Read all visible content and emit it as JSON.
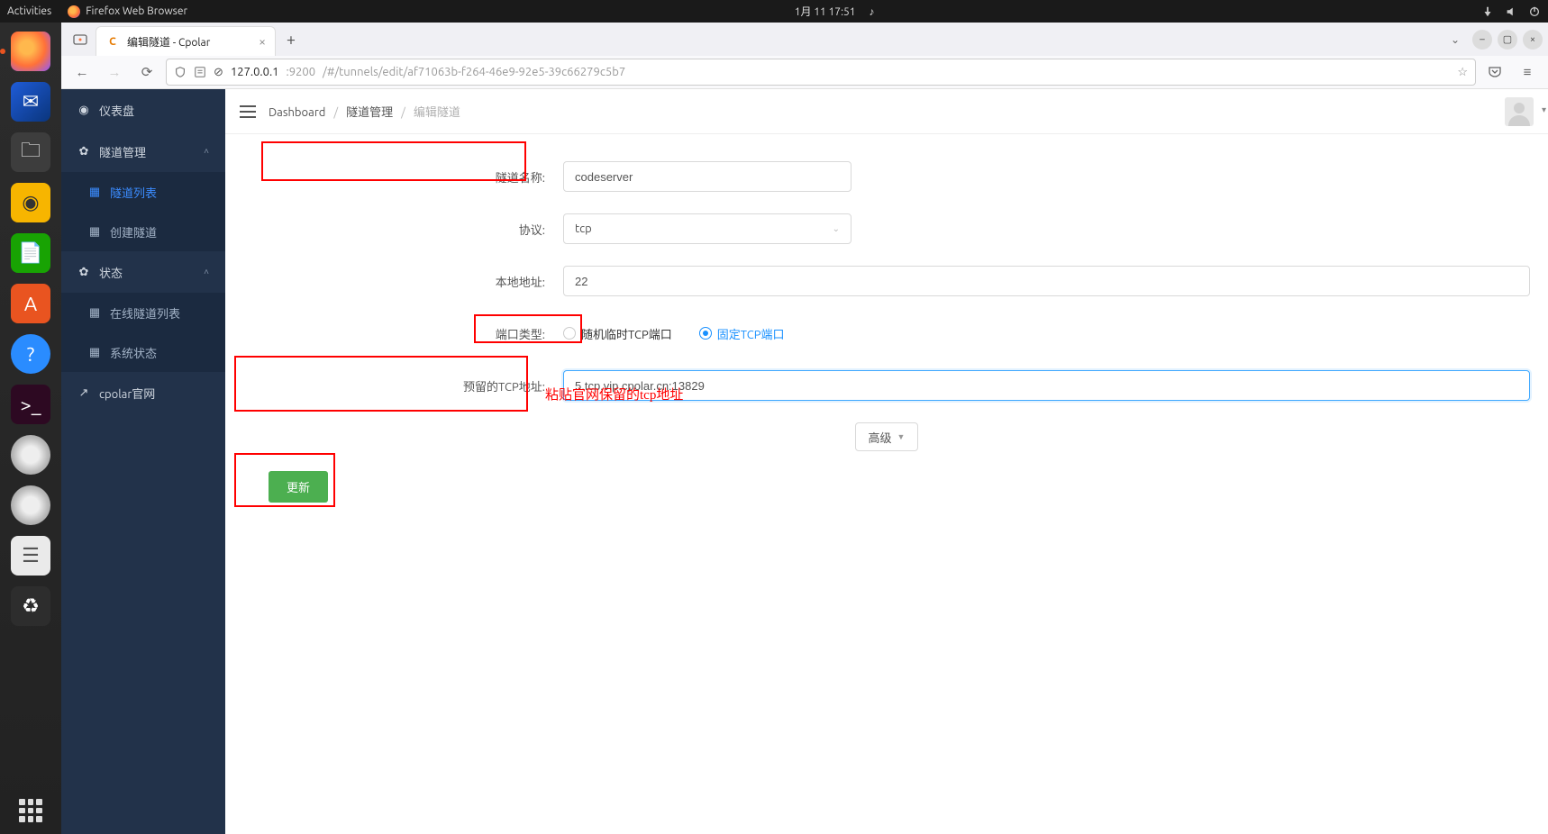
{
  "gnome": {
    "activities": "Activities",
    "app_name": "Firefox Web Browser",
    "datetime": "1月 11  17:51"
  },
  "browser": {
    "tab_title": "编辑隧道 - Cpolar",
    "tab_favicon_letter": "C",
    "url_host": "127.0.0.1",
    "url_port": ":9200",
    "url_path": "/#/tunnels/edit/af71063b-f264-46e9-92e5-39c66279c5b7"
  },
  "sidebar": {
    "dashboard": "仪表盘",
    "tunnel_mgmt": "隧道管理",
    "tunnel_list": "隧道列表",
    "create_tunnel": "创建隧道",
    "status": "状态",
    "online_tunnels": "在线隧道列表",
    "system_status": "系统状态",
    "cpolar_site": "cpolar官网"
  },
  "breadcrumb": {
    "a": "Dashboard",
    "b": "隧道管理",
    "c": "编辑隧道"
  },
  "labels": {
    "tunnel_name": "隧道名称:",
    "protocol": "协议:",
    "local_addr": "本地地址:",
    "port_type": "端口类型:",
    "reserved_tcp": "预留的TCP地址:"
  },
  "values": {
    "tunnel_name": "codeserver",
    "protocol": "tcp",
    "local_addr": "22",
    "reserved_tcp": "5.tcp.vip.cpolar.cn:13829"
  },
  "radios": {
    "random": "随机临时TCP端口",
    "fixed": "固定TCP端口"
  },
  "buttons": {
    "advanced": "高级",
    "update": "更新"
  },
  "annotation": {
    "paste_hint": "粘贴官网保留的tcp地址"
  }
}
